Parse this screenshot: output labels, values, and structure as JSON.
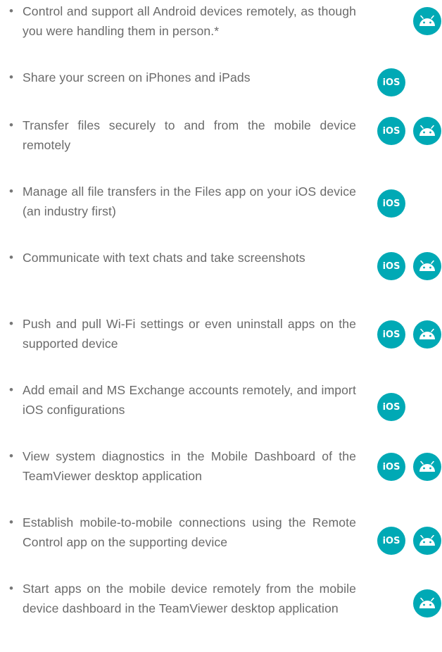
{
  "colors": {
    "accent": "#00a9b5",
    "text": "#6a6a6a"
  },
  "icons": {
    "ios": "ios-badge-icon",
    "android": "android-robot-icon"
  },
  "ios_label": "iOS",
  "features": [
    {
      "text": "Control and support all Android devices remotely, as though you were handling them in person.*",
      "platforms": [
        "android"
      ]
    },
    {
      "text": "Share your screen on iPhones and iPads",
      "platforms": [
        "ios"
      ]
    },
    {
      "text": "Transfer files securely to and from the mobile device remotely",
      "platforms": [
        "ios",
        "android"
      ]
    },
    {
      "text": "Manage all file transfers in the Files app on your iOS device (an industry first)",
      "platforms": [
        "ios"
      ]
    },
    {
      "text": "Communicate with text chats and take screenshots",
      "platforms": [
        "ios",
        "android"
      ]
    },
    {
      "text": "Push and pull Wi-Fi settings or even uninstall apps on the supported device",
      "platforms": [
        "ios",
        "android"
      ]
    },
    {
      "text": "Add email and MS Exchange accounts remotely, and import iOS configurations",
      "platforms": [
        "ios"
      ]
    },
    {
      "text": "View system diagnostics in the Mobile Dashboard of the TeamViewer desktop application",
      "platforms": [
        "ios",
        "android"
      ]
    },
    {
      "text": "Establish mobile-to-mobile connections using the Remote Control app on the supporting device",
      "platforms": [
        "ios",
        "android"
      ]
    },
    {
      "text": "Start apps on the mobile device remotely from the mobile device dashboard in the TeamViewer desktop application",
      "platforms": [
        "android"
      ]
    }
  ]
}
